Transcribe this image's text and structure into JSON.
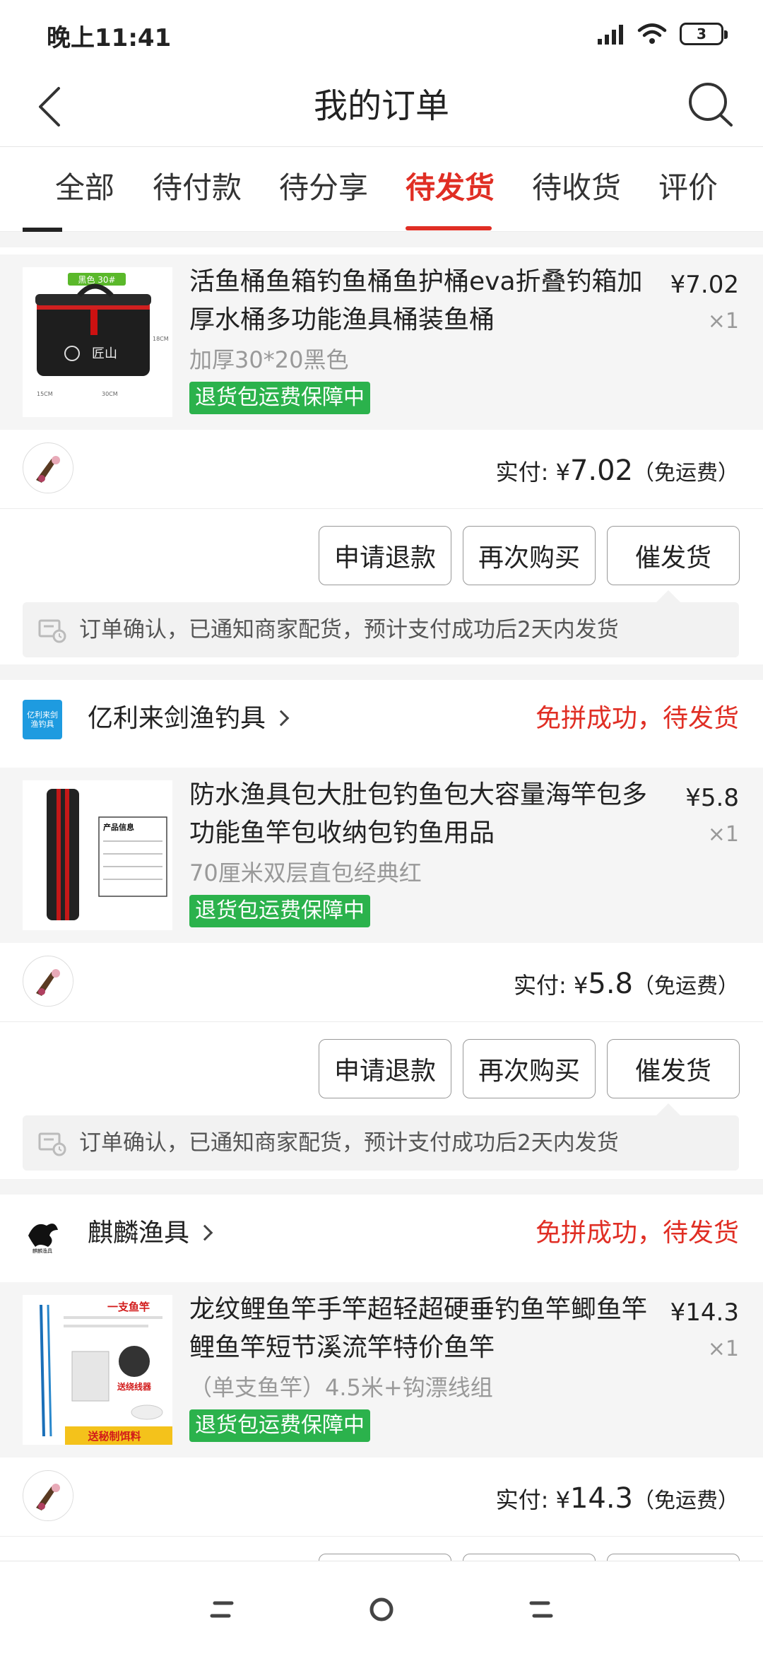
{
  "status": {
    "time": "晚上11:41",
    "battery": "3"
  },
  "header": {
    "title": "我的订单"
  },
  "tabs": [
    {
      "label": "全部"
    },
    {
      "label": "待付款"
    },
    {
      "label": "待分享"
    },
    {
      "label": "待发货",
      "active": true
    },
    {
      "label": "待收货"
    },
    {
      "label": "评价"
    }
  ],
  "orders": [
    {
      "goods": {
        "title": "活鱼桶鱼箱钓鱼桶鱼护桶eva折叠钓箱加厚水桶多功能渔具桶装鱼桶",
        "spec": "加厚30*20黑色",
        "badge": "退货包运费保障中",
        "price": "¥7.02",
        "qty": "×1",
        "image_text": {
          "tag": "黑色 30#",
          "brand": "匠山",
          "w": "30CM",
          "h": "18CM",
          "d": "15CM"
        }
      },
      "pay": {
        "label": "实付: ",
        "currency": "¥",
        "amount": "7.02",
        "note": "（免运费）"
      },
      "buttons": {
        "refund": "申请退款",
        "rebuy": "再次购买",
        "urge": "催发货"
      },
      "notice": "订单确认，已通知商家配货，预计支付成功后2天内发货"
    },
    {
      "shop": {
        "name": "亿利来剑渔钓具",
        "logo_text": "亿利来剑渔钓具"
      },
      "status": "免拼成功，待发货",
      "goods": {
        "title": "防水渔具包大肚包钓鱼包大容量海竿包多功能鱼竿包收纳包钓鱼用品",
        "spec": "70厘米双层直包经典红",
        "badge": "退货包运费保障中",
        "price": "¥5.8",
        "qty": "×1",
        "image_text": {
          "info": "产品信息"
        }
      },
      "pay": {
        "label": "实付: ",
        "currency": "¥",
        "amount": "5.8",
        "note": "（免运费）"
      },
      "buttons": {
        "refund": "申请退款",
        "rebuy": "再次购买",
        "urge": "催发货"
      },
      "notice": "订单确认，已通知商家配货，预计支付成功后2天内发货"
    },
    {
      "shop": {
        "name": "麒麟渔具",
        "logo_text": "麒麟渔具"
      },
      "status": "免拼成功，待发货",
      "goods": {
        "title": "龙纹鲤鱼竿手竿超轻超硬垂钓鱼竿鲫鱼竿鲤鱼竿短节溪流竿特价鱼竿",
        "spec": "（单支鱼竿）4.5米+钩漂线组",
        "badge": "退货包运费保障中",
        "price": "¥14.3",
        "qty": "×1",
        "image_text": {
          "top": "一支鱼竿",
          "mid": "送绕线器",
          "bottom": "送秘制饵料"
        }
      },
      "pay": {
        "label": "实付: ",
        "currency": "¥",
        "amount": "14.3",
        "note": "（免运费）"
      }
    }
  ],
  "colors": {
    "accent": "#e02e24",
    "badge": "#2bb24c"
  }
}
